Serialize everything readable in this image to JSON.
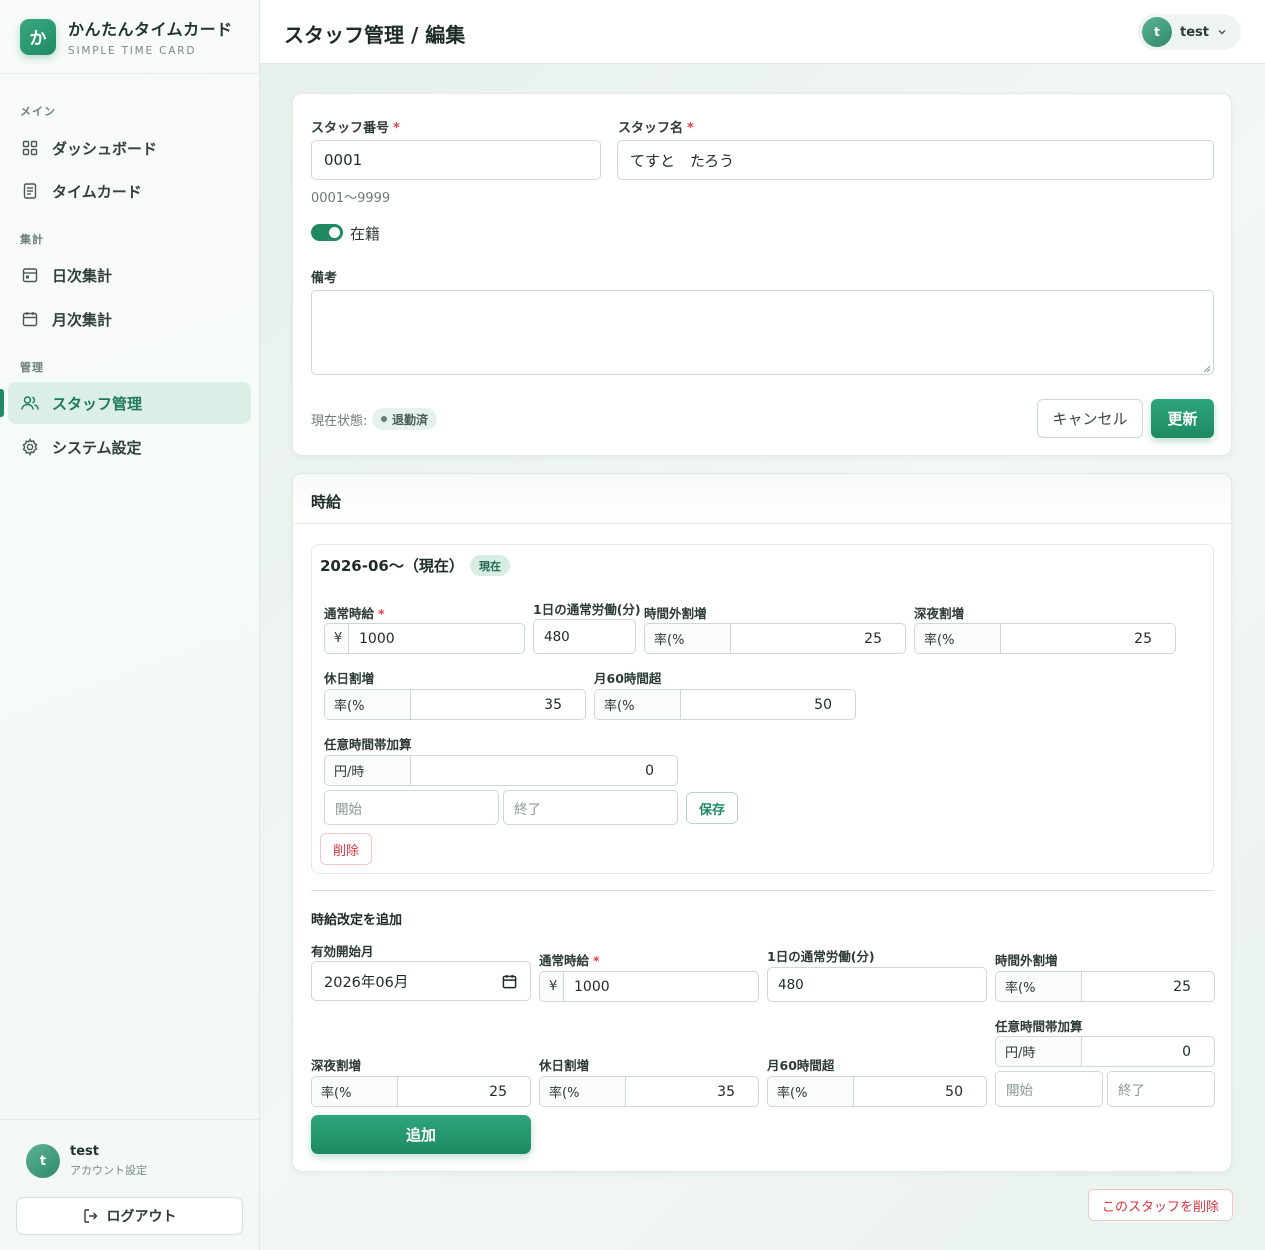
{
  "brand": {
    "logo_char": "か",
    "title": "かんたんタイムカード",
    "subtitle": "SIMPLE TIME CARD"
  },
  "sidebar": {
    "sections": [
      {
        "label": "メイン"
      },
      {
        "label": "集計"
      },
      {
        "label": "管理"
      }
    ],
    "items": [
      {
        "label": "ダッシュボード",
        "icon": "grid-icon"
      },
      {
        "label": "タイムカード",
        "icon": "document-icon"
      },
      {
        "label": "日次集計",
        "icon": "calendar-day-icon"
      },
      {
        "label": "月次集計",
        "icon": "calendar-icon"
      },
      {
        "label": "スタッフ管理",
        "icon": "users-icon",
        "active": true
      },
      {
        "label": "システム設定",
        "icon": "gear-icon"
      }
    ],
    "user": {
      "initial": "t",
      "name": "test",
      "sub": "アカウント設定"
    },
    "logout_label": "ログアウト"
  },
  "header": {
    "title": "スタッフ管理 / 編集",
    "user": {
      "initial": "t",
      "name": "test"
    }
  },
  "staff_form": {
    "number_label": "スタッフ番号",
    "number_value": "0001",
    "number_hint": "0001〜9999",
    "name_label": "スタッフ名",
    "name_value": "てすと　たろう",
    "required_mark": "*",
    "active_label": "在籍",
    "active": true,
    "notes_label": "備考",
    "notes_value": "",
    "status_label": "現在状態:",
    "status_value": "退勤済",
    "cancel_label": "キャンセル",
    "update_label": "更新"
  },
  "wage": {
    "section_title": "時給",
    "current": {
      "period": "2026-06〜（現在）",
      "current_badge": "現在",
      "base_label": "通常時給",
      "currency": "¥",
      "base_value": "1000",
      "daily_label": "1日の通常労働(分)",
      "daily_value": "480",
      "overtime_label": "時間外割増",
      "rate_prefix": "率(%",
      "overtime_value": "25",
      "night_label": "深夜割増",
      "night_value": "25",
      "holiday_label": "休日割増",
      "holiday_value": "35",
      "over60_label": "月60時間超",
      "over60_value": "50",
      "custom_label": "任意時間帯加算",
      "yen_prefix": "円/時",
      "custom_value": "0",
      "start_placeholder": "開始",
      "end_placeholder": "終了",
      "save_label": "保存",
      "delete_label": "削除"
    },
    "add": {
      "title": "時給改定を追加",
      "month_label": "有効開始月",
      "month_value": "2026年06月",
      "base_label": "通常時給",
      "currency": "¥",
      "base_value": "1000",
      "daily_label": "1日の通常労働(分)",
      "daily_value": "480",
      "overtime_label": "時間外割増",
      "rate_prefix": "率(%",
      "overtime_value": "25",
      "custom_label": "任意時間帯加算",
      "yen_prefix": "円/時",
      "custom_value": "0",
      "start_placeholder": "開始",
      "end_placeholder": "終了",
      "night_label": "深夜割増",
      "night_value": "25",
      "holiday_label": "休日割増",
      "holiday_value": "35",
      "over60_label": "月60時間超",
      "over60_value": "50",
      "add_label": "追加"
    }
  },
  "delete_staff_label": "このスタッフを削除",
  "colors": {
    "accent": "#1f8a62",
    "danger": "#d9363e"
  }
}
